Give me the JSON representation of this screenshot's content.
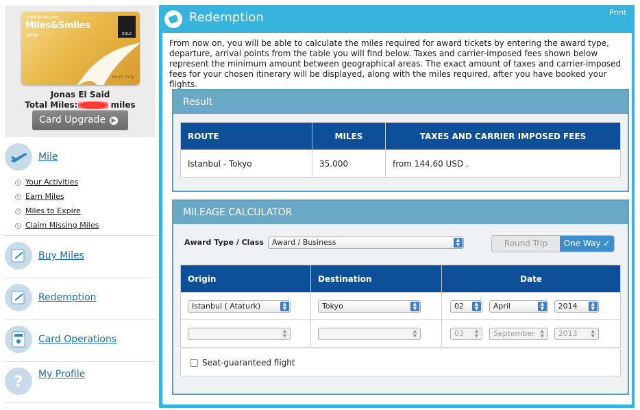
{
  "card": {
    "airline": "TURKISH AIRLINES",
    "brand": "Miles&Smiles",
    "tier": "elite",
    "alliance_badge": "GOLD",
    "signature": "Yours Truly"
  },
  "member": {
    "name": "Jonas El Said",
    "total_prefix": "Total Miles:",
    "total_suffix": " miles"
  },
  "card_upgrade_label": "Card Upgrade",
  "sidebar": {
    "mile": {
      "title": "Mile",
      "icon": "airplane-icon",
      "items": [
        "Your Activities",
        "Earn Miles",
        "Miles to Expire",
        "Claim Missing Miles"
      ]
    },
    "buy_miles": {
      "title": "Buy Miles",
      "icon": "buy-miles-icon"
    },
    "redemption": {
      "title": "Redemption",
      "icon": "redemption-icon"
    },
    "card_operations": {
      "title": "Card Operations",
      "icon": "card-operations-icon"
    },
    "my_profile": {
      "title": "My Profile",
      "icon": "question-icon"
    }
  },
  "main": {
    "title": "Redemption",
    "print": "Print",
    "intro": "From now on, you will be able to calculate the miles required for award tickets by entering the award type, departure, arrival points from the table you will find below. Taxes and carrier-imposed fees shown below represent the minimum amount between geographical areas. The exact amount of taxes and carrier-imposed fees for your chosen itinerary will be displayed, along with the miles required, after you have booked your flights."
  },
  "result": {
    "header": "Result",
    "columns": [
      "ROUTE",
      "MILES",
      "TAXES AND CARRIER IMPOSED FEES"
    ],
    "rows": [
      {
        "route": "Istanbul - Tokyo",
        "miles": "35.000",
        "fees": "from 144.60 USD ."
      }
    ]
  },
  "calculator": {
    "header": "MILEAGE CALCULATOR",
    "award_type_label": "Award Type / Class",
    "award_type_value": "Award / Business",
    "round_trip": "Round Trip",
    "one_way": "One Way",
    "columns": [
      "Origin",
      "Destination",
      "Date"
    ],
    "row1": {
      "origin": "Istanbul ( Ataturk)",
      "destination": "Tokyo",
      "day": "02",
      "month": "April",
      "year": "2014"
    },
    "row2": {
      "origin": "",
      "destination": "",
      "day": "03",
      "month": "September",
      "year": "2013"
    },
    "seat_guaranteed": "Seat-guaranteed flight"
  },
  "colors": {
    "accent": "#37b4de",
    "table_header": "#0d4f98",
    "panel_header": "#6aa9c6",
    "link": "#1d6ea3"
  }
}
